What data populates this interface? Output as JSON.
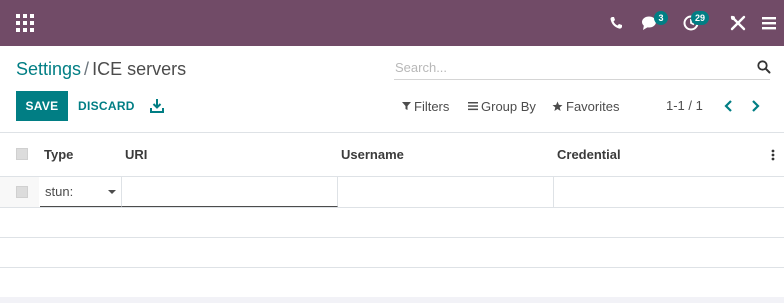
{
  "navbar": {
    "messages_count": "3",
    "activities_count": "29",
    "colors": {
      "bar": "#714b67",
      "badge": "#017e84"
    }
  },
  "breadcrumb": {
    "parent": "Settings",
    "separator": "/",
    "current": "ICE servers"
  },
  "search": {
    "placeholder": "Search..."
  },
  "toolbar": {
    "save_label": "SAVE",
    "discard_label": "DISCARD"
  },
  "filters": {
    "filters_label": "Filters",
    "group_by_label": "Group By",
    "favorites_label": "Favorites"
  },
  "pager": {
    "value": "1-1 / 1"
  },
  "table": {
    "columns": [
      "Type",
      "URI",
      "Username",
      "Credential"
    ],
    "editing_row": {
      "type_value": "stun:",
      "uri_value": "",
      "username_value": "",
      "credential_value": ""
    }
  },
  "accent_color": "#017e84"
}
